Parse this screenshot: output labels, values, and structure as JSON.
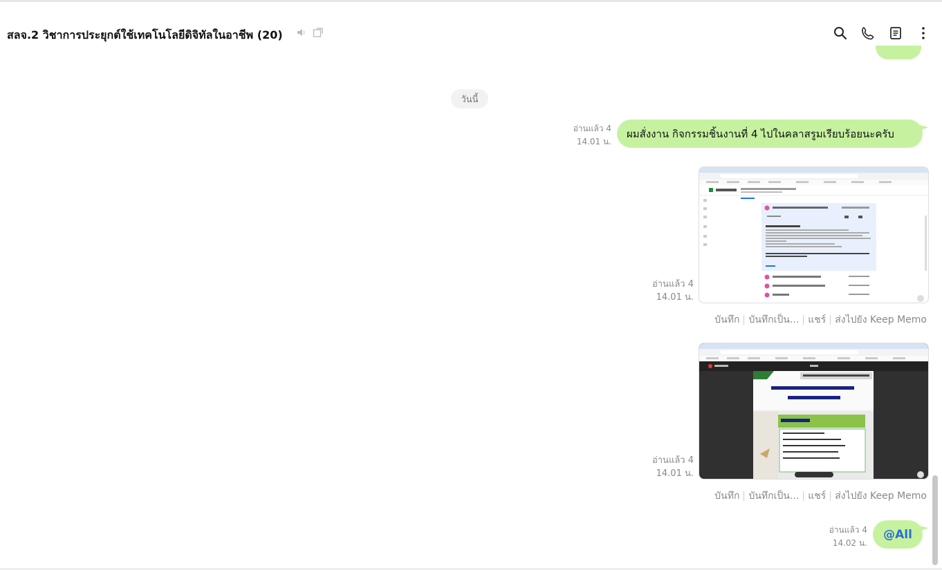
{
  "header": {
    "title": "สลจ.2 วิชาการประยุกต์ใช้เทคโนโลยีดิจิทัลในอาชีพ (20)",
    "icons": [
      "speaker-muted-icon",
      "popout-window-icon",
      "search-icon",
      "phone-icon",
      "notes-icon",
      "more-vertical-icon"
    ]
  },
  "date_separator": "วันนี้",
  "messages": [
    {
      "read": "อ่านแล้ว 4",
      "time": "14.01 น.",
      "text": "ผมสั่งงาน กิจกรรมชิ้นงานที่ 4 ไปในคลาสรูมเรียบร้อยนะครับ"
    },
    {
      "read": "อ่านแล้ว 4",
      "time": "14.01 น.",
      "image": "classroom-screenshot",
      "actions": [
        "บันทึก",
        "บันทึกเป็น...",
        "แชร์",
        "ส่งไปยัง Keep Memo"
      ]
    },
    {
      "read": "อ่านแล้ว 4",
      "time": "14.01 น.",
      "image": "slides-screenshot",
      "actions": [
        "บันทึก",
        "บันทึกเป็น...",
        "แชร์",
        "ส่งไปยัง Keep Memo"
      ]
    },
    {
      "read": "อ่านแล้ว 4",
      "time": "14.02 น.",
      "text": "@All"
    }
  ],
  "colors": {
    "bubble": "#c6f2a0",
    "mention": "#2a6fd1",
    "meta": "#888888"
  }
}
